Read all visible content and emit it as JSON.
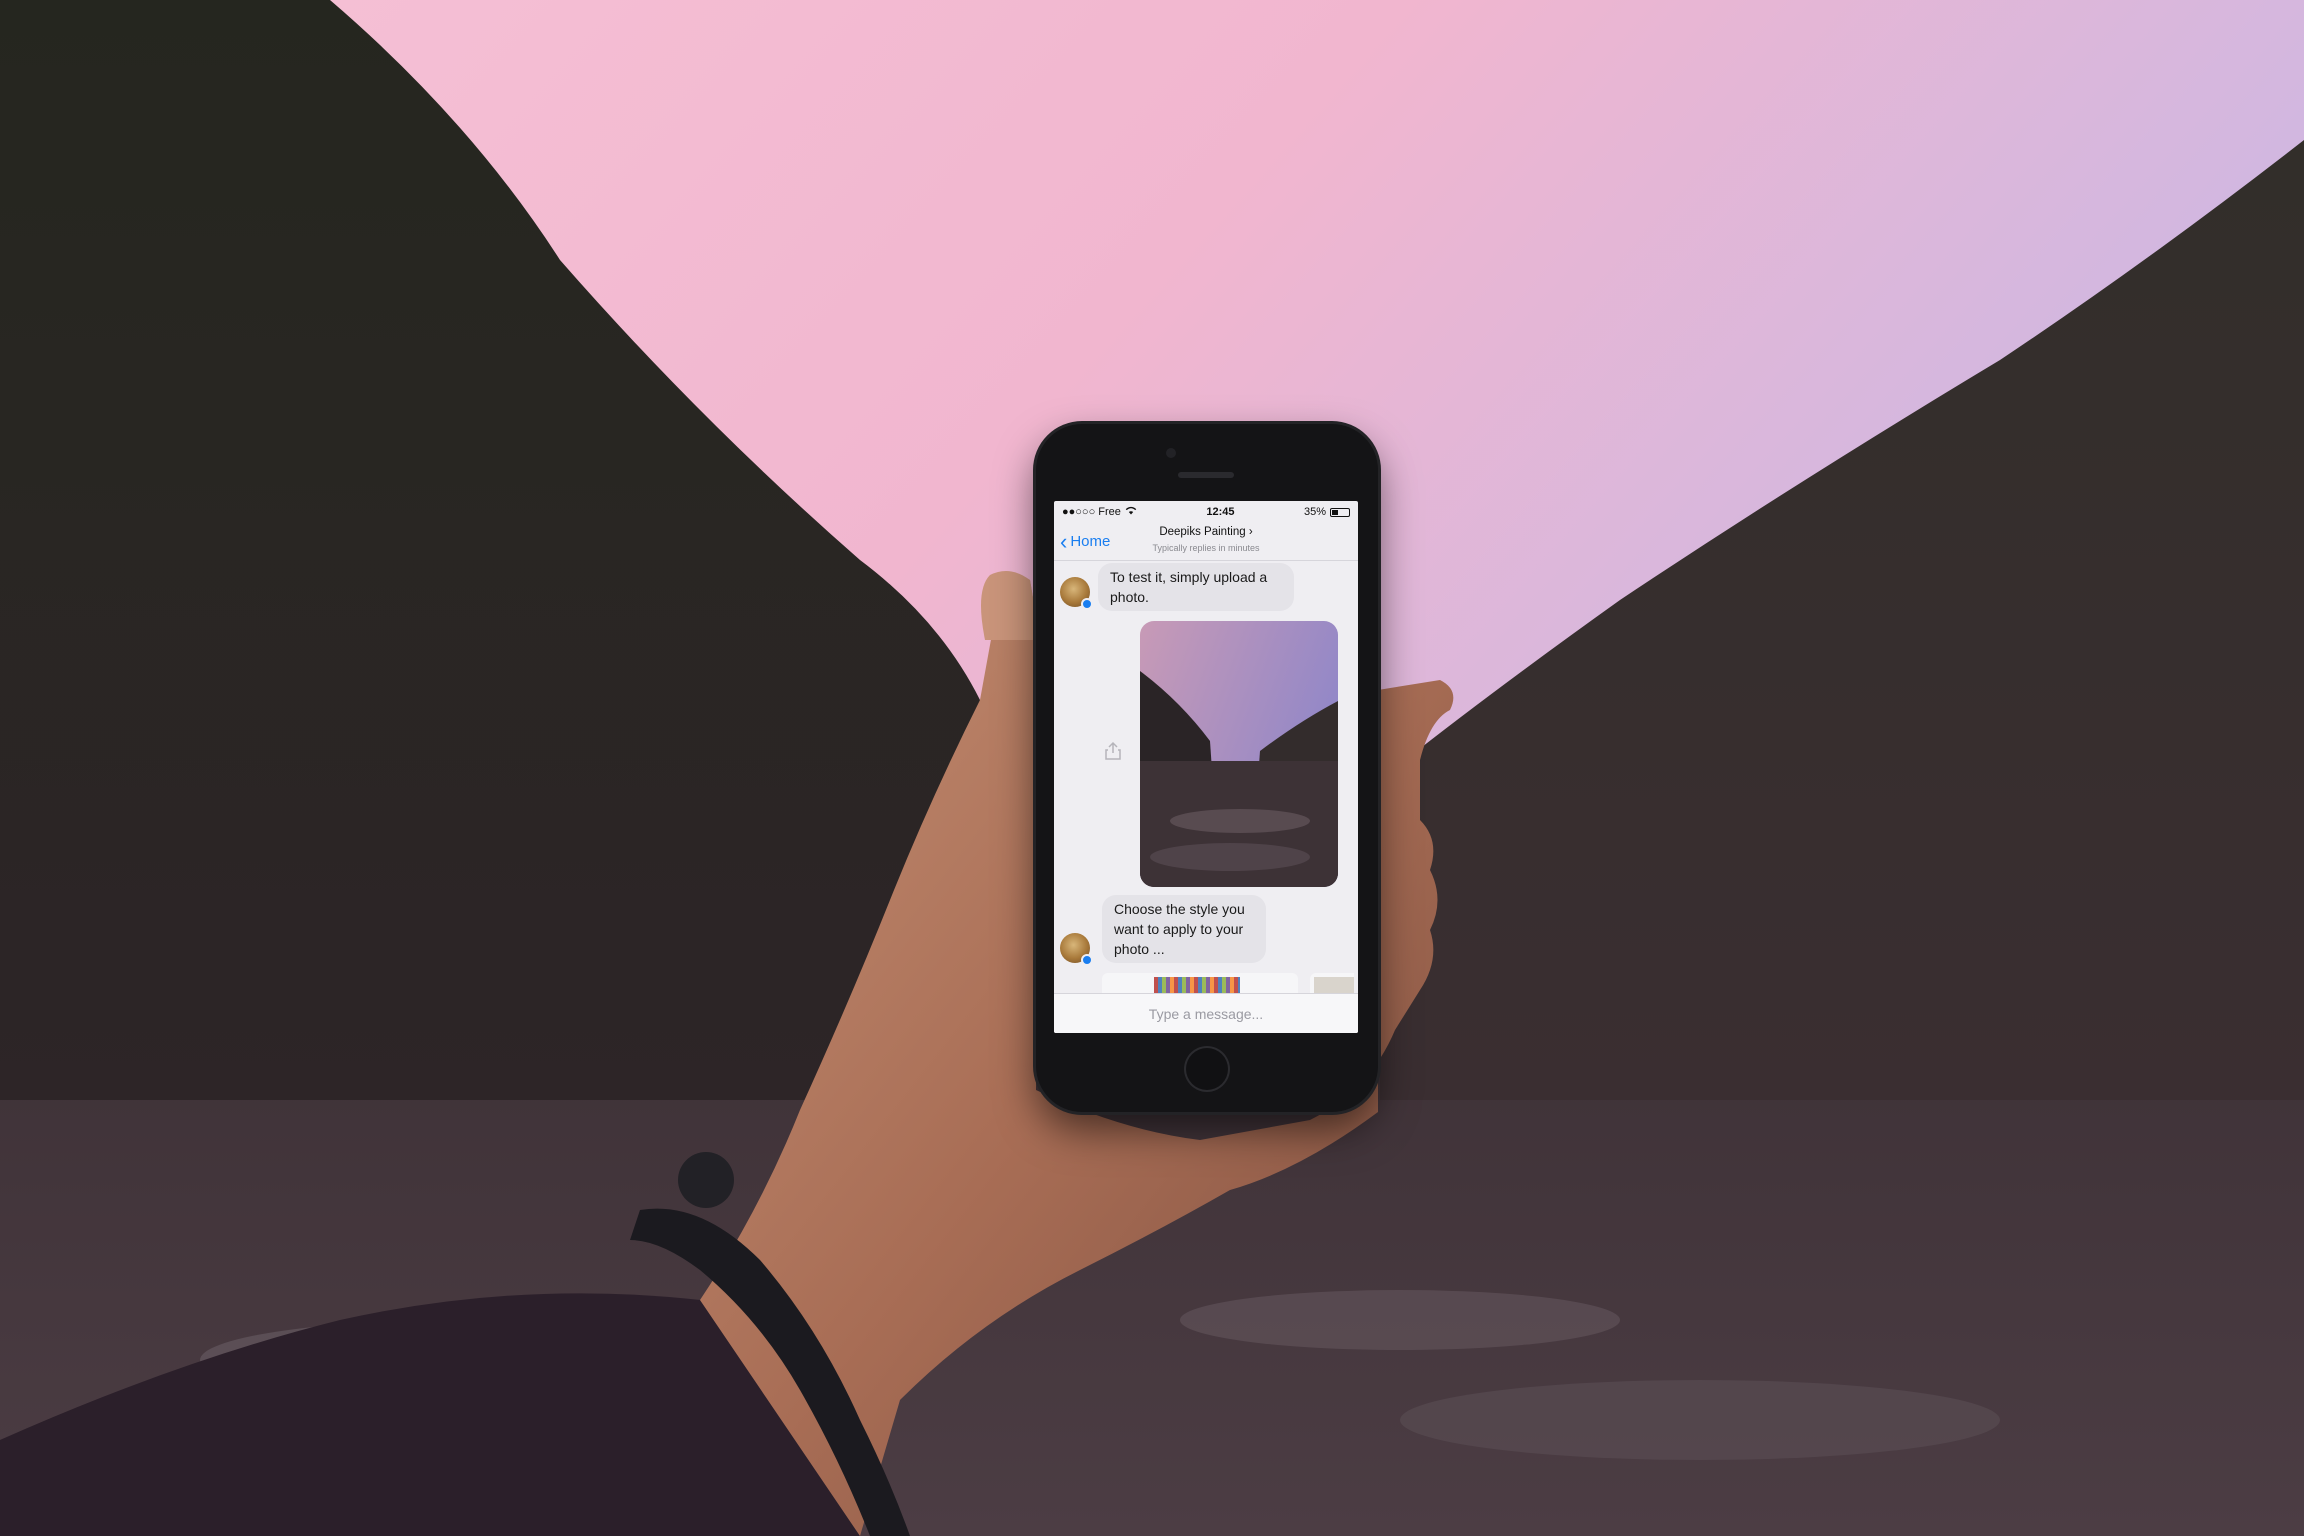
{
  "status_bar": {
    "carrier": "●●○○○ Free",
    "wifi_icon": "wifi-icon",
    "time": "12:45",
    "battery": "35%"
  },
  "nav": {
    "back_label": "Home",
    "title": "Deepiks Painting",
    "subtitle": "Typically replies in minutes"
  },
  "messages": [
    {
      "sender": "bot",
      "text": "To test it, simply upload a photo."
    },
    {
      "sender": "user",
      "type": "photo"
    },
    {
      "sender": "bot",
      "text": "Choose the style you want to apply to your photo ..."
    }
  ],
  "composer": {
    "placeholder": "Type a message..."
  },
  "colors": {
    "accent": "#1a7ef0",
    "bubble_bg": "#e4e3e8",
    "sky_pink": "#f0b7d0",
    "sky_lavender": "#c8c2ea"
  }
}
